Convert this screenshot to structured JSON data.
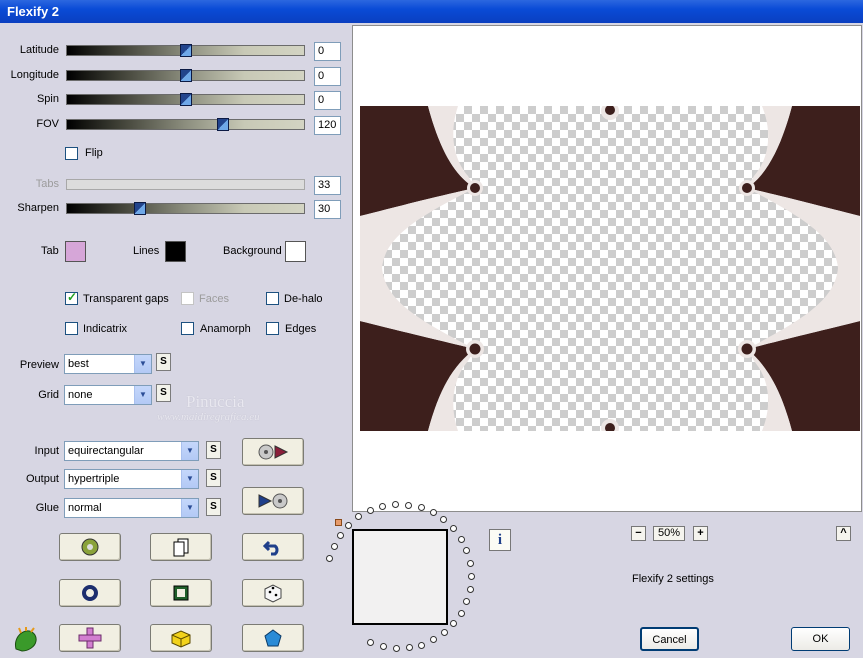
{
  "window": {
    "title": "Flexify 2"
  },
  "sliders": [
    {
      "label": "Latitude",
      "value": "0",
      "level": 0.5
    },
    {
      "label": "Longitude",
      "value": "0",
      "level": 0.5
    },
    {
      "label": "Spin",
      "value": "0",
      "level": 0.5
    },
    {
      "label": "FOV",
      "value": "120",
      "level": 0.66
    },
    {
      "label": "Tabs",
      "value": "33",
      "level": null
    },
    {
      "label": "Sharpen",
      "value": "30",
      "level": 0.31
    }
  ],
  "flip": {
    "label": "Flip",
    "checked": false
  },
  "colors": {
    "tab_label": "Tab",
    "tab_color": "#d6a6d8",
    "lines_label": "Lines",
    "lines_color": "#000000",
    "background_label": "Background",
    "background_color": "#ffffff"
  },
  "options": {
    "transparent_gaps": {
      "label": "Transparent gaps",
      "checked": true
    },
    "faces": {
      "label": "Faces",
      "checked": false
    },
    "de_halo": {
      "label": "De-halo",
      "checked": false
    },
    "indicatrix": {
      "label": "Indicatrix",
      "checked": false
    },
    "anamorph": {
      "label": "Anamorph",
      "checked": false
    },
    "edges": {
      "label": "Edges",
      "checked": false
    }
  },
  "preview_select": {
    "label": "Preview",
    "value": "best"
  },
  "grid_select": {
    "label": "Grid",
    "value": "none"
  },
  "input_select": {
    "label": "Input",
    "value": "equirectangular"
  },
  "output_select": {
    "label": "Output",
    "value": "hypertriple"
  },
  "glue_select": {
    "label": "Glue",
    "value": "normal"
  },
  "small_s": "S",
  "watermark": {
    "line1": "Pinuccia",
    "line2": "www.maidiregrafica.eu"
  },
  "zoom": {
    "minus": "−",
    "value": "50%",
    "plus": "+",
    "up": "^"
  },
  "info_icon": "i",
  "status_text": "Flexify 2 settings",
  "buttons": {
    "cancel": "Cancel",
    "ok": "OK"
  },
  "accent_colors": {
    "title_bar": "#0a4bd6",
    "image_dark": "#3d1f1c",
    "image_light": "#ede6e4"
  }
}
